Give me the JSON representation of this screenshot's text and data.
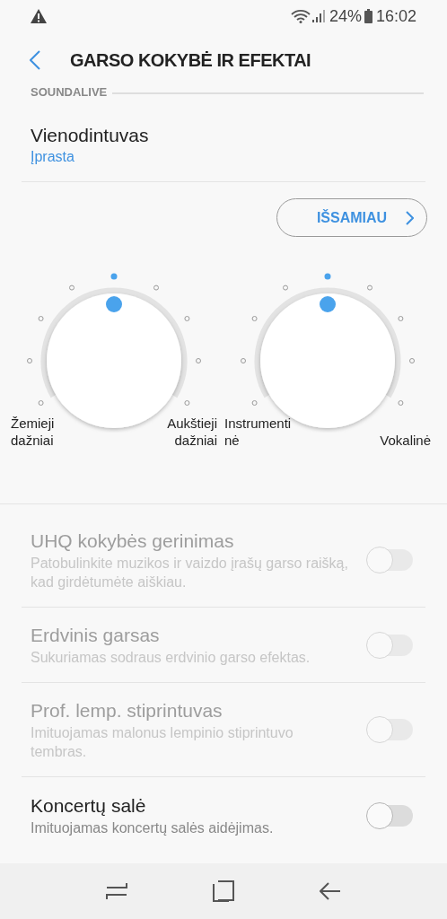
{
  "status_bar": {
    "battery": "24%",
    "time": "16:02"
  },
  "header": {
    "title": "GARSO KOKYBĖ IR EFEKTAI"
  },
  "section": {
    "title": "SOUNDALIVE"
  },
  "equalizer": {
    "title": "Vienodintuvas",
    "value": "Įprasta"
  },
  "details_button": {
    "label": "IŠSAMIAU"
  },
  "knobs": [
    {
      "left_label": [
        "Žemieji",
        "dažniai"
      ],
      "right_label": [
        "Aukštieji",
        "dažniai"
      ]
    },
    {
      "left_label": [
        "Instrumenti",
        "nė"
      ],
      "right_label": [
        "Vokalinė"
      ]
    }
  ],
  "settings": [
    {
      "title": "UHQ kokybės gerinimas",
      "description": "Patobulinkite muzikos ir vaizdo įrašų garso raišką, kad girdėtumėte aiškiau.",
      "disabled": true,
      "on": false
    },
    {
      "title": "Erdvinis garsas",
      "description": "Sukuriamas sodraus erdvinio garso efektas.",
      "disabled": true,
      "on": false
    },
    {
      "title": "Prof. lemp. stiprintuvas",
      "description": "Imituojamas malonus lempinio stiprintuvo tembras.",
      "disabled": true,
      "on": false
    },
    {
      "title": "Koncertų salė",
      "description": "Imituojamas koncertų salės aidėjimas.",
      "disabled": false,
      "on": false
    }
  ]
}
